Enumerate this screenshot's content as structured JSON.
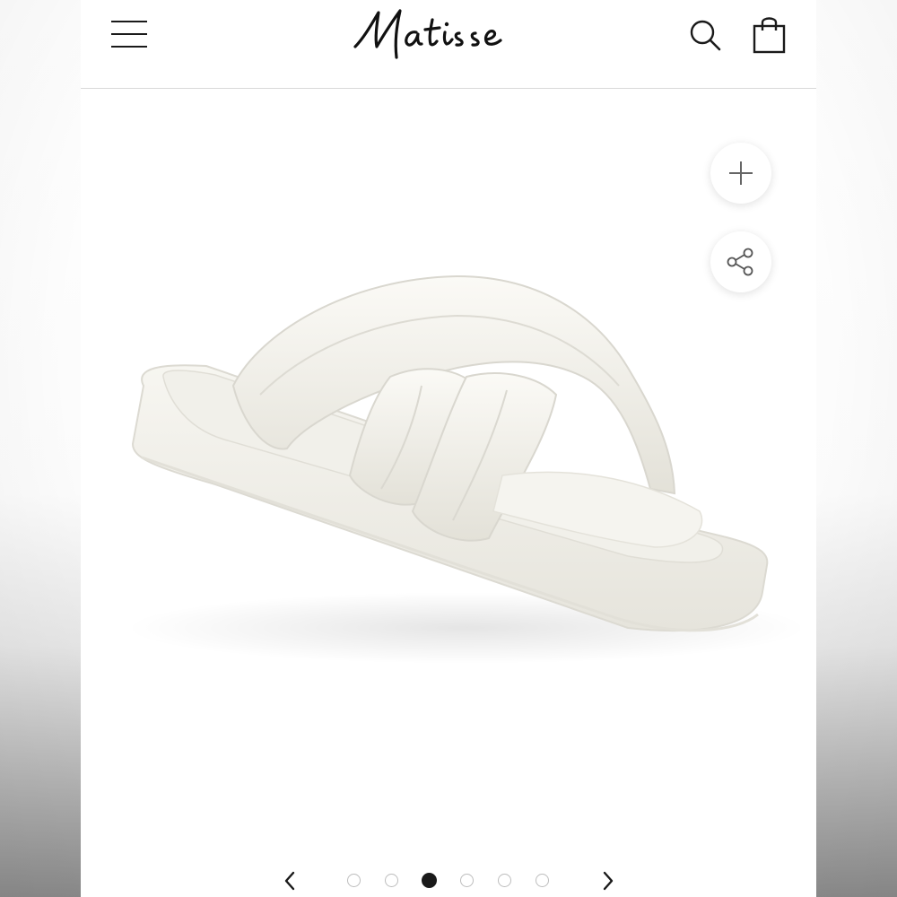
{
  "brand": {
    "name": "Matisse"
  },
  "header": {
    "menu_icon": "hamburger-menu-icon",
    "search_icon": "search-icon",
    "cart_icon": "shopping-bag-icon"
  },
  "product_gallery": {
    "product_color": "#f3f2ec",
    "actions": [
      {
        "name": "zoom",
        "icon": "plus-icon"
      },
      {
        "name": "share",
        "icon": "share-icon"
      }
    ],
    "carousel": {
      "prev_icon": "chevron-left-icon",
      "next_icon": "chevron-right-icon",
      "slide_count": 6,
      "active_index": 2
    }
  },
  "colors": {
    "accent": "#1a1a1a",
    "divider": "#d9d9d9"
  }
}
